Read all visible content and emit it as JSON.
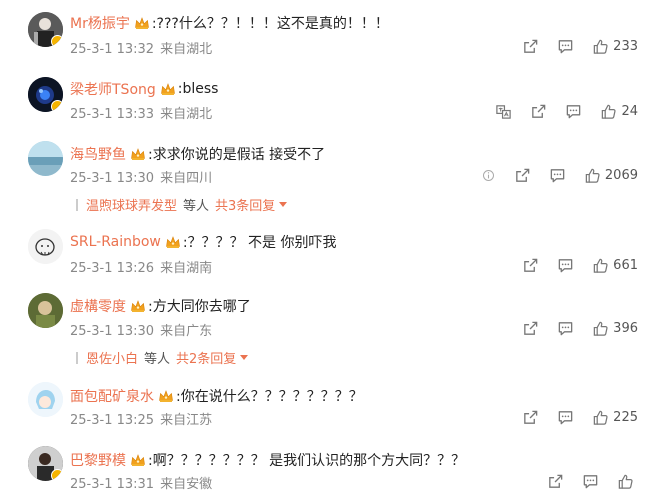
{
  "colors": {
    "username": "#eb7350",
    "meta": "#888888",
    "icon": "#666666",
    "badge": "#f5b400"
  },
  "comments": [
    {
      "username": "Mr杨振宇",
      "text": ":???什么？？！！！这不是真的！！！",
      "time": "25-3-1 13:32",
      "location": "来自湖北",
      "likes": "233"
    },
    {
      "username": "梁老师TSong",
      "text": ":bless",
      "time": "25-3-1 13:33",
      "location": "来自湖北",
      "likes": "24"
    },
    {
      "username": "海鸟野鱼",
      "text": ":求求你说的是假话 接受不了",
      "time": "25-3-1 13:30",
      "location": "来自四川",
      "likes": "2069",
      "replies": {
        "user": "温煦球球弄发型",
        "etc": "等人",
        "total": "共3条回复"
      }
    },
    {
      "username": "SRL-Rainbow",
      "text": ":？？？？ 不是 你别吓我",
      "time": "25-3-1 13:26",
      "location": "来自湖南",
      "likes": "661"
    },
    {
      "username": "虚構零度",
      "text": ":方大同你去哪了",
      "time": "25-3-1 13:30",
      "location": "来自广东",
      "likes": "396",
      "replies": {
        "user": "恩佐小白",
        "etc": "等人",
        "total": "共2条回复"
      }
    },
    {
      "username": "面包配矿泉水",
      "text": ":你在说什么？？？？？？？？",
      "time": "25-3-1 13:25",
      "location": "来自江苏",
      "likes": "225"
    },
    {
      "username": "巴黎野模",
      "text": ":啊？？？？？？？ 是我们认识的那个方大同？？？",
      "time": "25-3-1 13:31",
      "location": "来自安徽",
      "likes": ""
    }
  ]
}
